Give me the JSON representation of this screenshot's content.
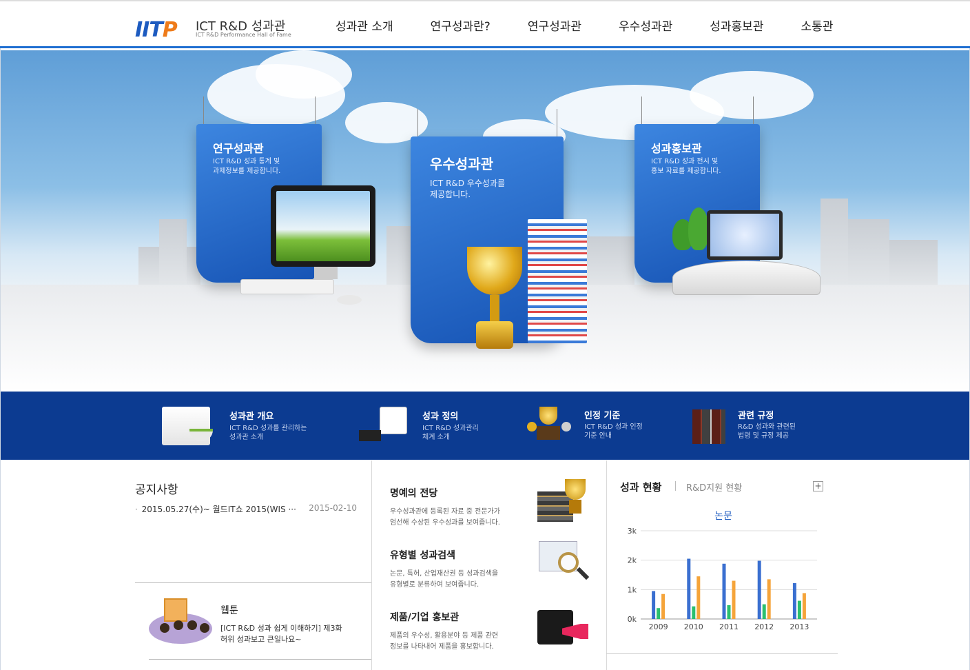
{
  "header": {
    "logo_mark": "IITP",
    "logo_title": "ICT R&D 성과관",
    "logo_subtitle": "ICT R&D Performance Hall of Fame",
    "nav": [
      "성과관 소개",
      "연구성과란?",
      "연구성과관",
      "우수성과관",
      "성과홍보관",
      "소통관"
    ]
  },
  "hero": {
    "panels": [
      {
        "title": "연구성과관",
        "desc_1": "ICT R&D 성과 통계 및",
        "desc_2": "과제정보를 제공합니다."
      },
      {
        "title": "우수성과관",
        "desc_1": "ICT R&D 우수성과를",
        "desc_2": "제공합니다."
      },
      {
        "title": "성과홍보관",
        "desc_1": "ICT R&D 성과 전시 및",
        "desc_2": "홍보 자료를 제공합니다."
      }
    ]
  },
  "services": [
    {
      "title": "성과관 개요",
      "desc_1": "ICT R&D 성과를 관리하는",
      "desc_2": "성과관 소개"
    },
    {
      "title": "성과 정의",
      "desc_1": "ICT R&D 성과관리",
      "desc_2": "체계 소개"
    },
    {
      "title": "인정 기준",
      "desc_1": "ICT R&D 성과 인정",
      "desc_2": "기준 안내"
    },
    {
      "title": "관련 규정",
      "desc_1": "R&D 성과와 관련된",
      "desc_2": "법령 및 규정 제공"
    }
  ],
  "notice": {
    "title": "공지사항",
    "items": [
      {
        "text": "2015.05.27(수)~ 월드IT쇼 2015(WIS ···",
        "date": "2015-02-10"
      }
    ]
  },
  "webtoon": {
    "title": "웹툰",
    "desc_1": "[ICT R&D 성과 쉽게 이해하기] 제3화",
    "desc_2": "허위 성과보고 큰일나요~"
  },
  "hall": [
    {
      "title": "명예의 전당",
      "desc_1": "우수성과관에 등록된 자료 중 전문가가",
      "desc_2": "엄선해 수상된 우수성과를 보여줍니다."
    },
    {
      "title": "유형별 성과검색",
      "desc_1": "논문, 특허, 산업재산권 등 성과검색을",
      "desc_2": "유형별로 분류하여 보여줍니다."
    },
    {
      "title": "제품/기업 홍보관",
      "desc_1": "제품의 우수성, 활용분야 등 제품 관련",
      "desc_2": "정보를 나타내어 제품을 홍보합니다."
    }
  ],
  "stats": {
    "tab_active": "성과 현황",
    "tab_inactive": "R&D지원 현황",
    "more_label": "+"
  },
  "chart_data": {
    "type": "bar",
    "title": "논문",
    "categories": [
      "2009",
      "2010",
      "2011",
      "2012",
      "2013"
    ],
    "series": [
      {
        "values": [
          950,
          2050,
          1880,
          1980,
          1220
        ],
        "color": "#3a6fd0"
      },
      {
        "values": [
          370,
          430,
          470,
          500,
          620
        ],
        "color": "#2bbf6f"
      },
      {
        "values": [
          850,
          1450,
          1300,
          1350,
          880
        ],
        "color": "#f5a43a"
      }
    ],
    "yticks": [
      "0k",
      "1k",
      "2k",
      "3k"
    ],
    "ylim": [
      0,
      3000
    ],
    "grid": true
  },
  "colors": {
    "brand_blue": "#1d5bc0",
    "strip": "#0c3b91",
    "accent": "#ee7b1a"
  }
}
